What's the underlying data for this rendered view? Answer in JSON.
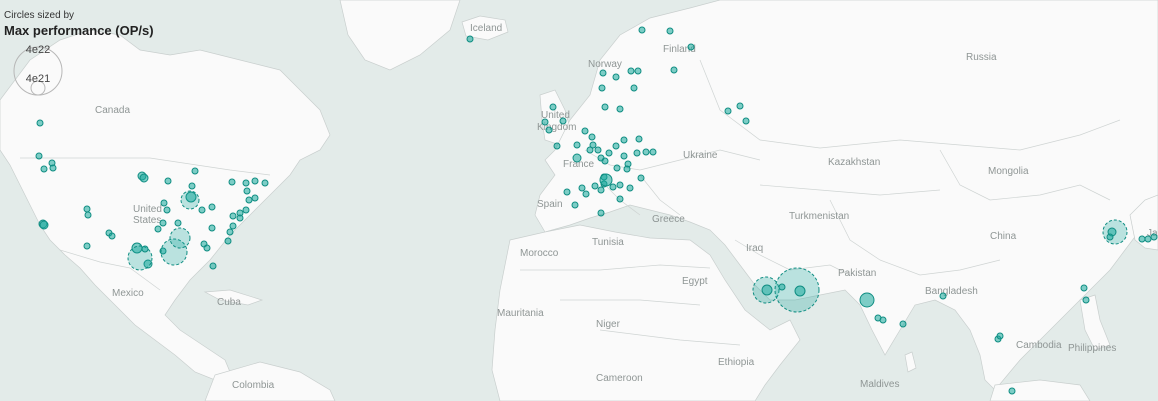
{
  "legend": {
    "subtitle": "Circles sized by",
    "title": "Max performance (OP/s)",
    "large_value": "4e22",
    "small_value": "4e21"
  },
  "map_labels": [
    {
      "key": "iceland",
      "text": "Iceland"
    },
    {
      "key": "finland",
      "text": "Finland"
    },
    {
      "key": "norway",
      "text": "Norway"
    },
    {
      "key": "russia",
      "text": "Russia"
    },
    {
      "key": "canada",
      "text": "Canada"
    },
    {
      "key": "uk1",
      "text": "United"
    },
    {
      "key": "uk2",
      "text": "Kingdom"
    },
    {
      "key": "ukraine",
      "text": "Ukraine"
    },
    {
      "key": "kazakhstan",
      "text": "Kazakhstan"
    },
    {
      "key": "mongolia",
      "text": "Mongolia"
    },
    {
      "key": "france",
      "text": "France"
    },
    {
      "key": "us1",
      "text": "United"
    },
    {
      "key": "us2",
      "text": "States"
    },
    {
      "key": "spain",
      "text": "Spain"
    },
    {
      "key": "greece",
      "text": "Greece"
    },
    {
      "key": "turkmenistan",
      "text": "Turkmenistan"
    },
    {
      "key": "china",
      "text": "China"
    },
    {
      "key": "tunisia",
      "text": "Tunisia"
    },
    {
      "key": "morocco",
      "text": "Morocco"
    },
    {
      "key": "iraq",
      "text": "Iraq"
    },
    {
      "key": "pakistan",
      "text": "Pakistan"
    },
    {
      "key": "egypt",
      "text": "Egypt"
    },
    {
      "key": "mexico",
      "text": "Mexico"
    },
    {
      "key": "cuba",
      "text": "Cuba"
    },
    {
      "key": "bangladesh",
      "text": "Bangladesh"
    },
    {
      "key": "mauritania",
      "text": "Mauritania"
    },
    {
      "key": "niger",
      "text": "Niger"
    },
    {
      "key": "ethiopia",
      "text": "Ethiopia"
    },
    {
      "key": "cambodia",
      "text": "Cambodia"
    },
    {
      "key": "philippines",
      "text": "Philippines"
    },
    {
      "key": "cameroon",
      "text": "Cameroon"
    },
    {
      "key": "maldives",
      "text": "Maldives"
    },
    {
      "key": "colombia",
      "text": "Colombia"
    },
    {
      "key": "japan",
      "text": "Ja"
    }
  ],
  "colors": {
    "ocean": "#e3ebe9",
    "land": "#fafafa",
    "marker": "#16a79a"
  }
}
